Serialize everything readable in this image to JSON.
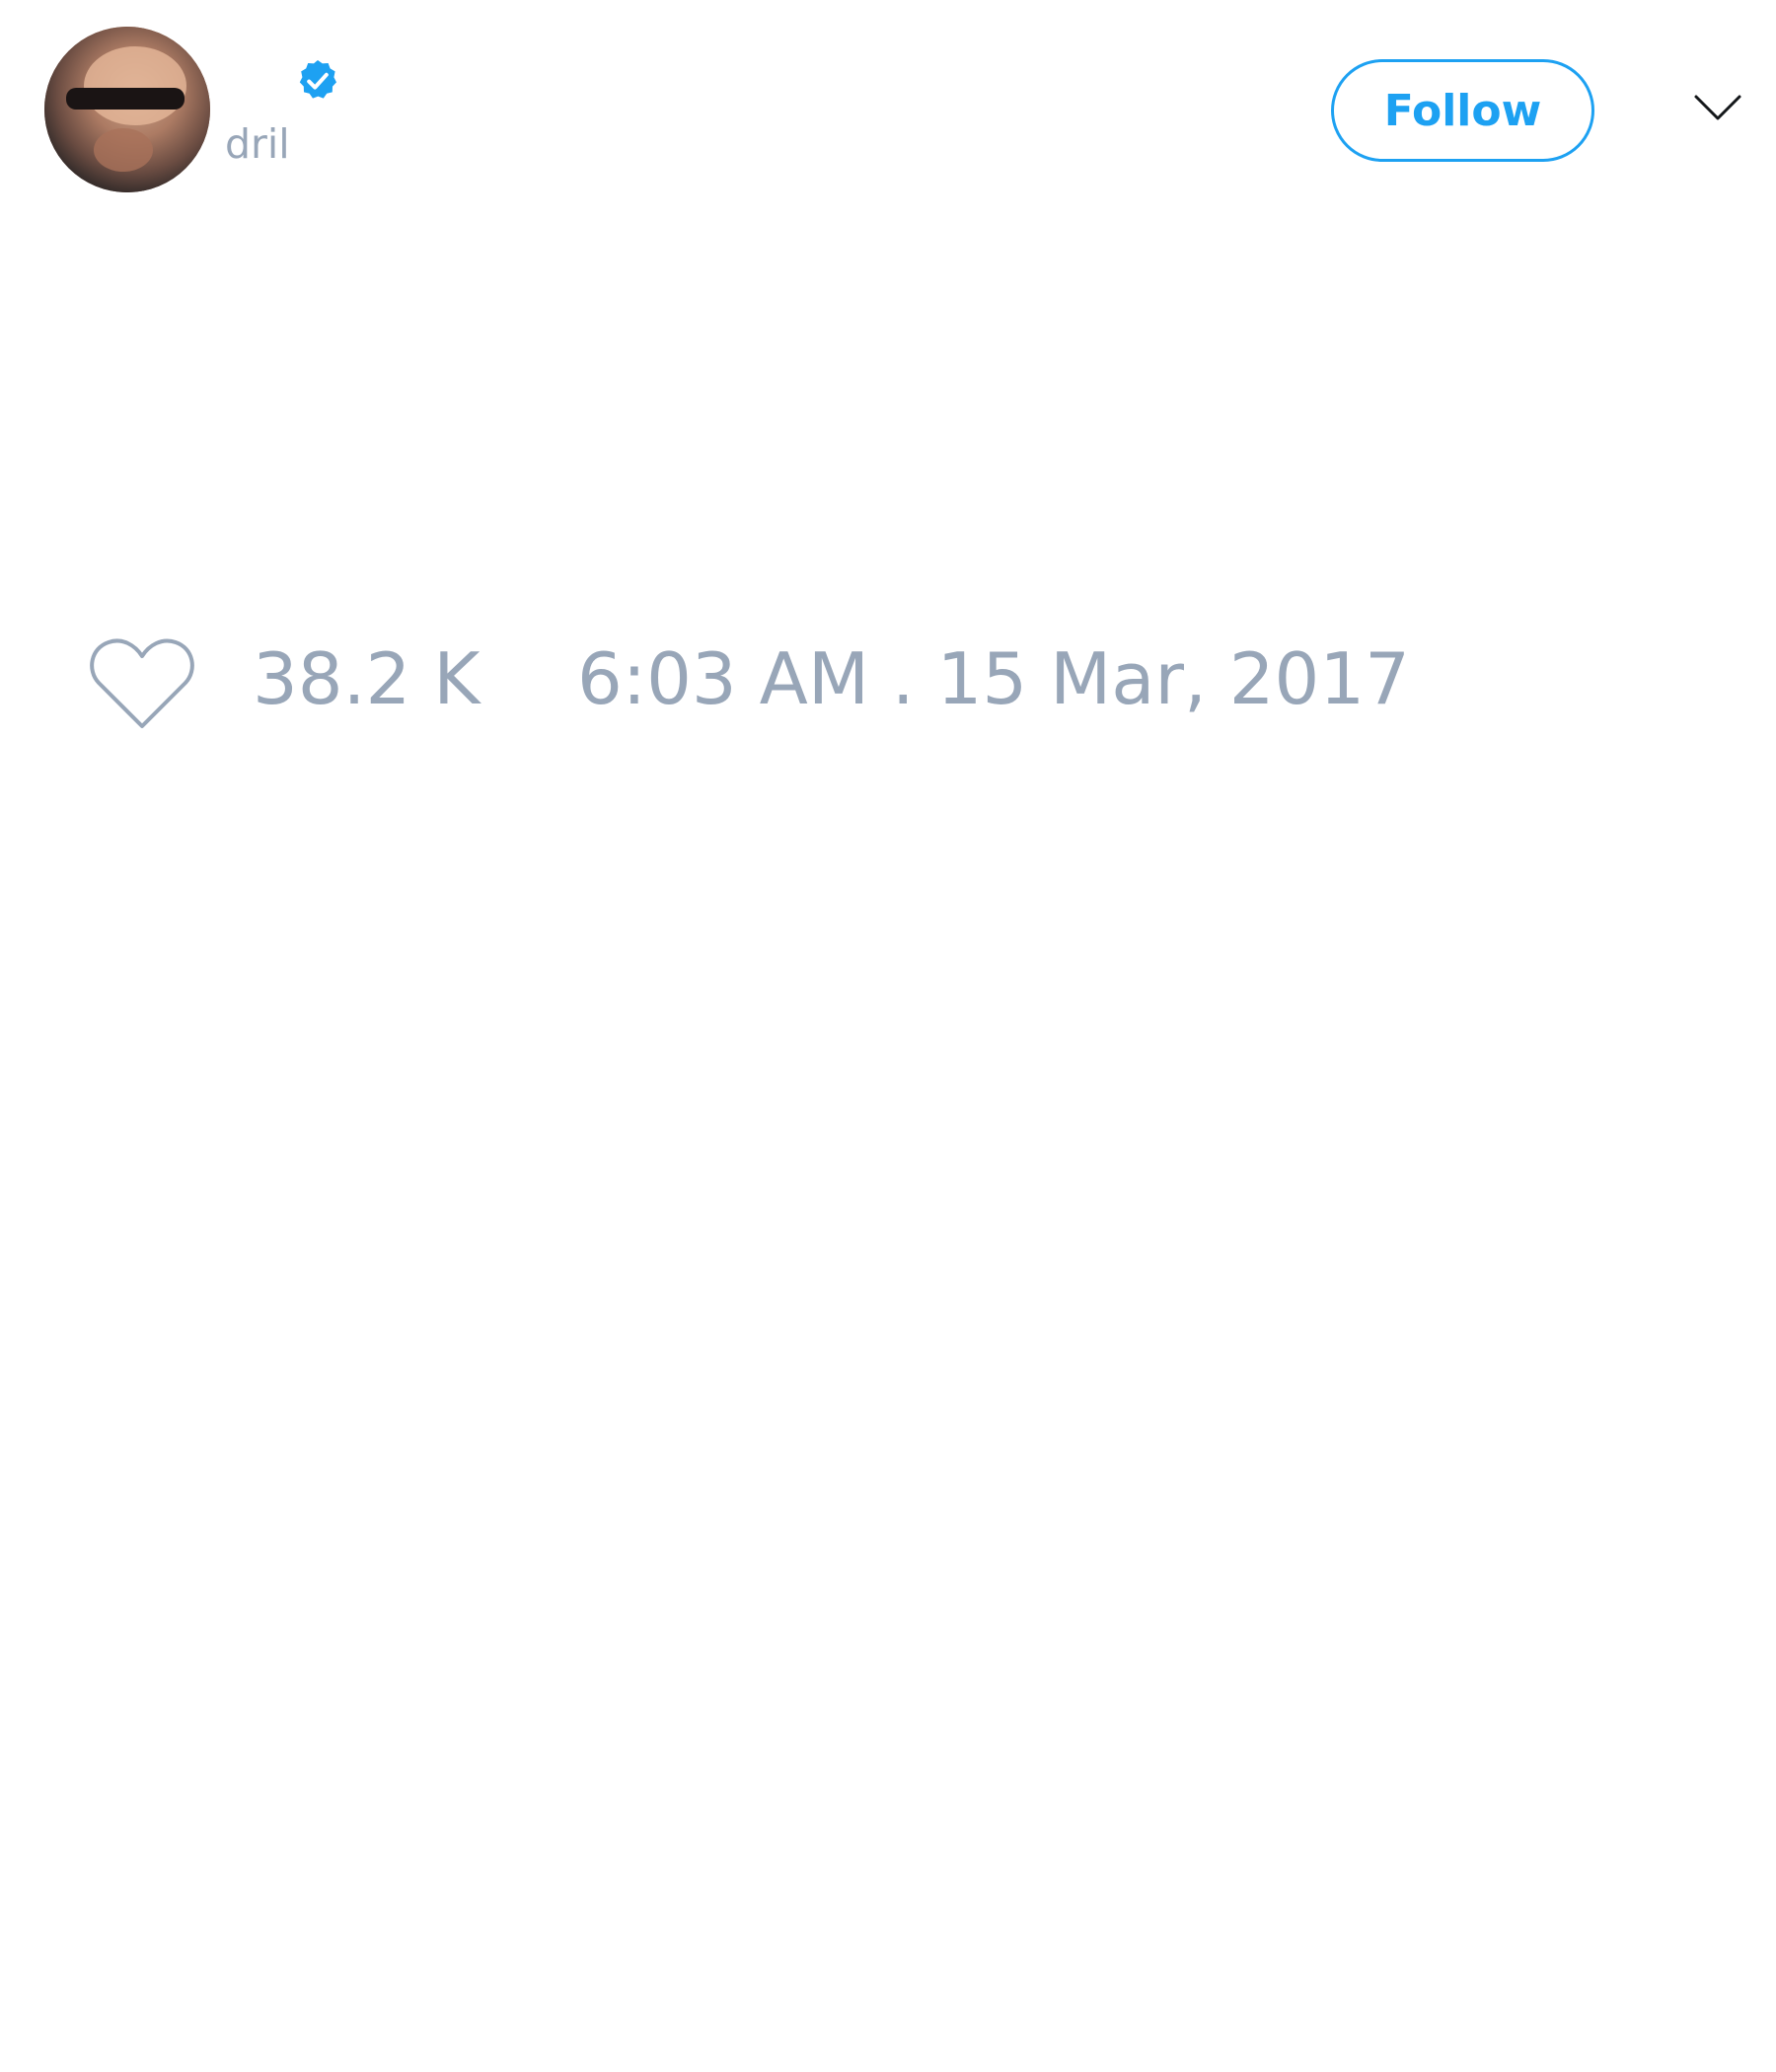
{
  "tweet": {
    "author": {
      "handle": "dril",
      "verified": true
    },
    "follow_label": "Follow",
    "likes": "38.2 K",
    "timestamp": "6:03 AM . 15 Mar, 2017"
  },
  "icons": {
    "verified": "verified-badge-icon",
    "menu": "chevron-down-icon",
    "like": "heart-icon"
  },
  "colors": {
    "accent": "#1da1f2",
    "muted_text": "#98a6b8",
    "background": "#ffffff"
  }
}
